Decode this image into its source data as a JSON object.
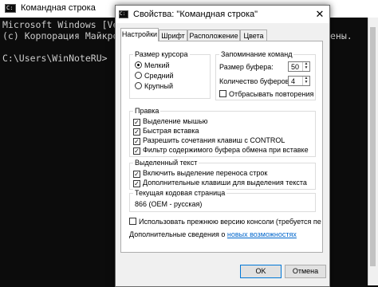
{
  "console": {
    "title": "Командная строка",
    "icon": "cmd-icon",
    "lines": [
      "Microsoft Windows [Version",
      "(c) Корпорация Майкрософт",
      "",
      "C:\\Users\\WinNoteRU>"
    ],
    "line_tail": "ены."
  },
  "dialog": {
    "title": "Свойства: \"Командная строка\"",
    "close": "✕",
    "tabs": [
      {
        "label": "Настройки",
        "active": true
      },
      {
        "label": "Шрифт",
        "active": false
      },
      {
        "label": "Расположение",
        "active": false
      },
      {
        "label": "Цвета",
        "active": false
      }
    ],
    "cursor_size": {
      "label": "Размер курсора",
      "options": [
        {
          "label": "Мелкий",
          "selected": true
        },
        {
          "label": "Средний",
          "selected": false
        },
        {
          "label": "Крупный",
          "selected": false
        }
      ]
    },
    "command_history": {
      "label": "Запоминание команд",
      "buffer_size_label": "Размер буфера:",
      "buffer_size_value": "50",
      "buffer_count_label": "Количество буферов:",
      "buffer_count_value": "4",
      "discard_duplicates_label": "Отбрасывать повторения",
      "discard_duplicates_checked": false
    },
    "edit": {
      "label": "Правка",
      "items": [
        {
          "label": "Выделение мышью",
          "checked": true
        },
        {
          "label": "Быстрая вставка",
          "checked": true
        },
        {
          "label": "Разрешить сочетания клавиш с CONTROL",
          "checked": true
        },
        {
          "label": "Фильтр содержимого буфера обмена при вставке",
          "checked": true
        }
      ]
    },
    "text_selection": {
      "label": "Выделенный текст",
      "items": [
        {
          "label": "Включить выделение переноса строк",
          "checked": true
        },
        {
          "label": "Дополнительные клавиши для выделения текста",
          "checked": true
        }
      ]
    },
    "code_page": {
      "label": "Текущая кодовая страница",
      "value": "866   (OEM - русская)"
    },
    "legacy_console_label": "Использовать прежнюю версию консоли (требуется пе",
    "legacy_console_checked": false,
    "more_info_prefix": "Дополнительные сведения о ",
    "more_info_link": "новых возможностях",
    "buttons": {
      "ok": "OK",
      "cancel": "Отмена"
    }
  }
}
